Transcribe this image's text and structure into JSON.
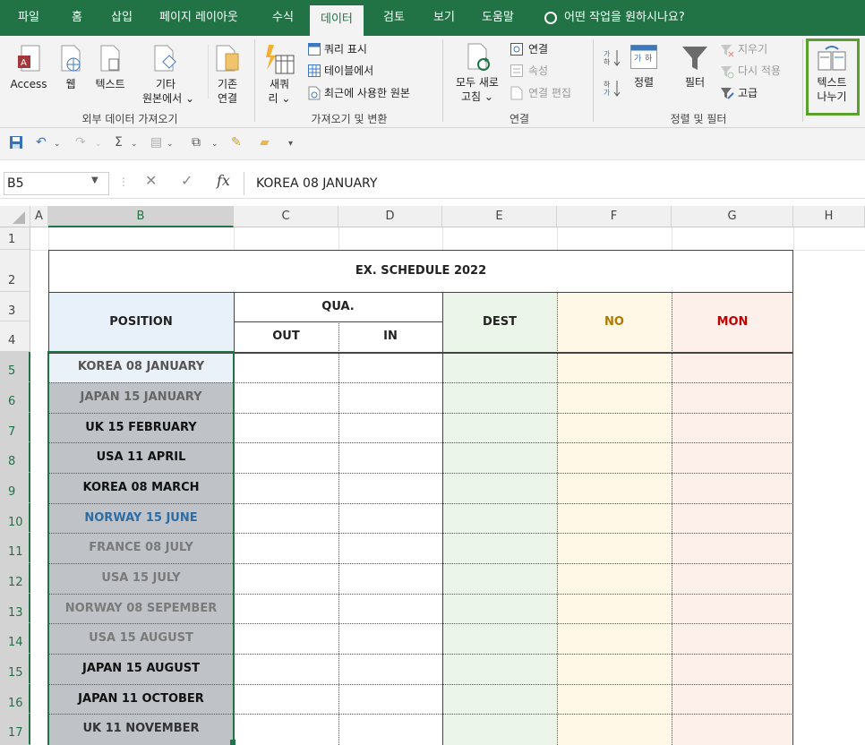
{
  "ribbon_tabs": [
    "파일",
    "홈",
    "삽입",
    "페이지 레이아웃",
    "수식",
    "데이터",
    "검토",
    "보기",
    "도움말"
  ],
  "active_tab": "데이터",
  "tell_me": "어떤 작업을 원하시나요?",
  "groups": {
    "external": {
      "label": "외부 데이터 가져오기",
      "access": "Access",
      "web": "웹",
      "text": "텍스트",
      "other_1": "기타",
      "other_2": "원본에서 ⌄",
      "existing_1": "기존",
      "existing_2": "연결"
    },
    "transform": {
      "label": "가져오기 및 변환",
      "new_query_1": "새쿼",
      "new_query_2": "리 ⌄",
      "show_queries": "쿼리 표시",
      "from_table": "테이블에서",
      "recent_sources": "최근에 사용한 원본"
    },
    "connections": {
      "label": "연결",
      "refresh_all_1": "모두 새로",
      "refresh_all_2": "고침 ⌄",
      "connections": "연결",
      "properties": "속성",
      "edit_links": "연결 편집"
    },
    "sort_filter": {
      "label": "정렬 및 필터",
      "sort": "정렬",
      "filter": "필터",
      "clear": "지우기",
      "reapply": "다시 적용",
      "advanced": "고급"
    },
    "data_tools": {
      "text_to_columns_1": "텍스트",
      "text_to_columns_2": "나누기"
    }
  },
  "namebox": "B5",
  "formula": "KOREA 08 JANUARY",
  "fx_label": "fx",
  "columns": [
    "A",
    "B",
    "C",
    "D",
    "E",
    "F",
    "G",
    "H"
  ],
  "rows": [
    "1",
    "2",
    "3",
    "4",
    "5",
    "6",
    "7",
    "8",
    "9",
    "10",
    "11",
    "12",
    "13",
    "14",
    "15",
    "16",
    "17"
  ],
  "sheet": {
    "title": "EX. SCHEDULE 2022",
    "position_header": "POSITION",
    "qua_header": "QUA.",
    "out_header": "OUT",
    "in_header": "IN",
    "dest_header": "DEST",
    "no_header": "NO",
    "mon_header": "MON",
    "positions": [
      "KOREA 08 JANUARY",
      "JAPAN 15 JANUARY",
      "UK 15 FEBRUARY",
      "USA 11 APRIL",
      "KOREA 08 MARCH",
      "NORWAY 15 JUNE",
      "FRANCE 08 JULY",
      "USA 15 JULY",
      "NORWAY 08 SEPEMBER",
      "USA 15 AUGUST",
      "JAPAN 15 AUGUST",
      "JAPAN 11 OCTOBER",
      "UK 11 NOVEMBER"
    ]
  },
  "colors": {
    "brand_green": "#217346",
    "selection_fill": "#bfc3c8",
    "position_header_fill": "#e8f1fa",
    "dest_fill": "#ecf5ea",
    "no_fill": "#fff8e6",
    "mon_fill": "#fdf0ea",
    "no_text": "#b07800",
    "mon_text": "#c00000",
    "norway_june_text": "#2e6da4",
    "grey_text": "#7a7a7a",
    "highlight_box": "#5aa02c"
  }
}
